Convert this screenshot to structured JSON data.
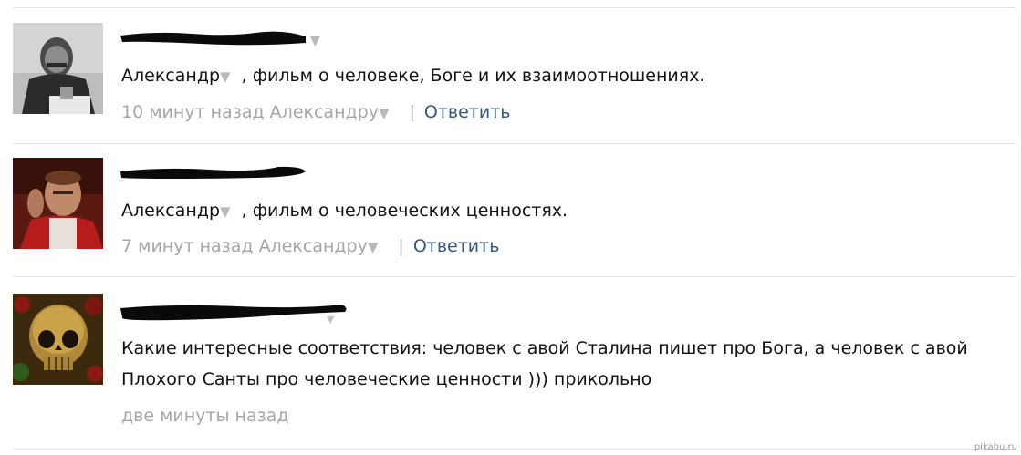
{
  "comments": [
    {
      "avatar_icon": "stalin-portrait-avatar",
      "reply_to_name": "Александр",
      "text": ", фильм о человеке, Боге и их взаимоотношениях.",
      "time": "10 минут назад",
      "reply_target": "Александру",
      "reply_label": "Ответить"
    },
    {
      "avatar_icon": "bad-santa-avatar",
      "reply_to_name": "Александр",
      "text": ", фильм о человеческих ценностях.",
      "time": "7 минут назад",
      "reply_target": "Александру",
      "reply_label": "Ответить"
    },
    {
      "avatar_icon": "skull-avatar",
      "text_line1": "Какие интересные соответствия: человек с авой Сталина пишет про Бога, а человек с авой",
      "text_line2": "Плохого Санты про человеческие ценности ))) прикольно",
      "time": "две минуты назад"
    }
  ],
  "watermark": "pikabu.ru",
  "dropdown_glyph": "▼",
  "colors": {
    "link": "#37587e",
    "meta": "#a6a6a6",
    "divider": "#dfe3e8"
  }
}
